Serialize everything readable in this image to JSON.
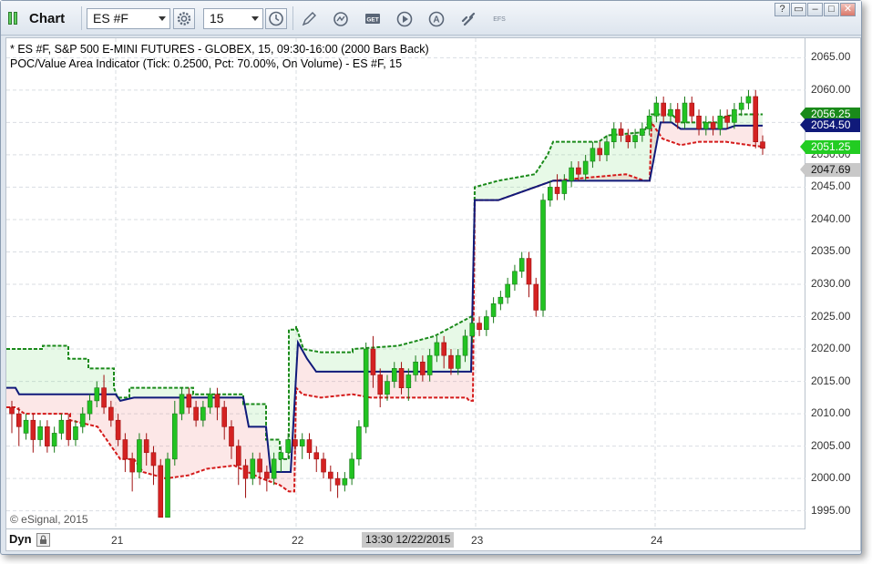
{
  "window": {
    "title": "Chart",
    "controls": [
      "?",
      "▭",
      "–",
      "□",
      "✕"
    ]
  },
  "toolbar": {
    "symbol": "ES #F",
    "interval": "15",
    "icons": [
      "gear-icon",
      "clock-icon",
      "pencil-icon",
      "refresh-icon",
      "get-icon",
      "play-icon",
      "a-icon",
      "link-icon",
      "efs-icon"
    ],
    "get_label": "GET",
    "a_label": "A",
    "efs_label": "EFS"
  },
  "chart": {
    "legend_line1": "* ES #F, S&P 500 E-MINI FUTURES - GLOBEX, 15, 09:30-16:00 (2000 Bars Back)",
    "legend_line2": "POC/Value Area Indicator (Tick: 0.2500, Pct: 70.00%, On Volume) - ES #F, 15",
    "copyright": "© eSignal, 2015",
    "price_tags": [
      {
        "label": "2056.25",
        "color": "#1a8a1a",
        "price": 2056.25
      },
      {
        "label": "2054.50",
        "color": "#101a7a",
        "price": 2054.5
      },
      {
        "label": "2051.25",
        "color": "#22cc22",
        "price": 2051.25
      },
      {
        "label": "2047.69",
        "color": "#c8c8c8",
        "price": 2047.69
      }
    ],
    "price_ticks": [
      "2065.00",
      "2060.00",
      "2055.00",
      "2050.00",
      "2045.00",
      "2040.00",
      "2035.00",
      "2030.00",
      "2025.00",
      "2020.00",
      "2015.00",
      "2010.00",
      "2005.00",
      "2000.00",
      "1995.00"
    ],
    "time_labels": [
      "21",
      "22",
      "23",
      "24"
    ],
    "cursor_time": "13:30 12/22/2015",
    "dyn_label": "Dyn"
  },
  "chart_data": {
    "type": "candlestick",
    "symbol": "ES #F",
    "interval": "15",
    "ylim": [
      1992,
      2068
    ],
    "y_ticks": [
      2065,
      2060,
      2055,
      2050,
      2045,
      2040,
      2035,
      2030,
      2025,
      2020,
      2015,
      2010,
      2005,
      2000,
      1995
    ],
    "x_labels": [
      "21",
      "22",
      "23",
      "24"
    ],
    "grid": true,
    "sessions": [
      {
        "day": "21",
        "poc": 2013.0,
        "vah_start": 2020.0,
        "val_start": 2011.0
      },
      {
        "day": "22",
        "poc": 2016.5,
        "vah_start": 2023.0,
        "val_start": 2014.0
      },
      {
        "day": "23",
        "poc": 2043.0,
        "vah_start": 2046.0,
        "val_start": 2043.0
      },
      {
        "day": "24",
        "poc": 2054.5,
        "vah_start": 2056.25,
        "val_start": 2051.25
      }
    ]
  }
}
